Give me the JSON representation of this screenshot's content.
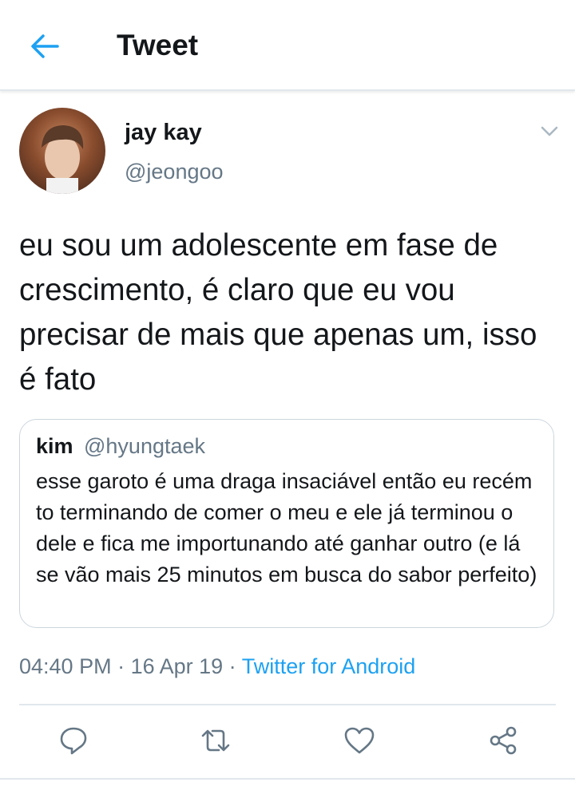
{
  "header": {
    "title": "Tweet"
  },
  "tweet": {
    "author_name": "jay kay",
    "author_handle": "@jeongoo",
    "text": "eu sou um adolescente em fase de crescimento, é claro que eu vou precisar de mais que apenas um, isso é fato"
  },
  "quote": {
    "name": "kim",
    "handle": "@hyungtaek",
    "text": "esse garoto é uma draga insaciável então eu recém to terminando de comer o meu e ele já terminou o dele e fica me importunando até ganhar outro (e lá se vão mais 25 minutos em busca do sabor perfeito)"
  },
  "meta": {
    "time": "04:40 PM",
    "sep1": " · ",
    "date": "16 Apr 19",
    "sep2": " · ",
    "source": "Twitter for Android"
  },
  "icons": {
    "back": "arrow-left-icon",
    "menu": "chevron-down-icon",
    "reply": "reply-icon",
    "retweet": "retweet-icon",
    "like": "heart-icon",
    "share": "share-icon"
  },
  "colors": {
    "accent": "#1da1f2",
    "secondary_text": "#657786",
    "border": "#e1e8ed"
  }
}
